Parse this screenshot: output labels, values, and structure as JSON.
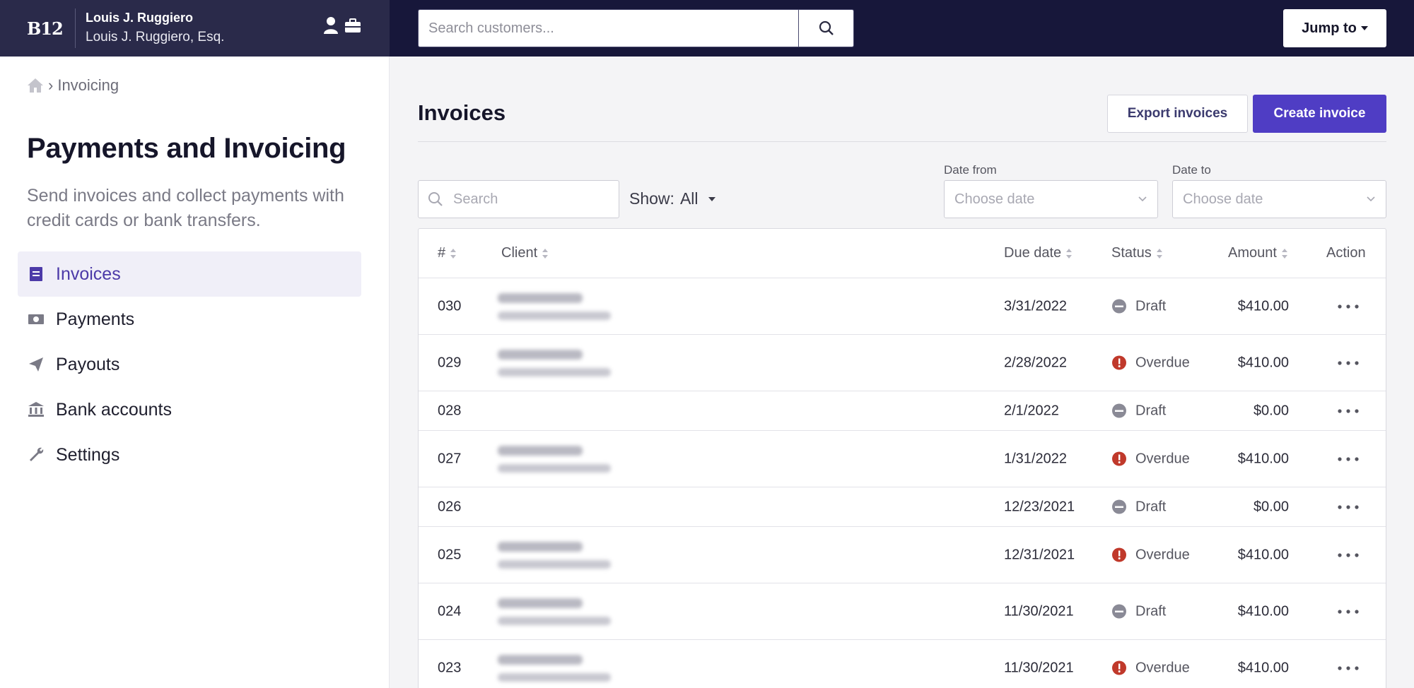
{
  "colors": {
    "accent": "#4f3dc4",
    "topbar": "#17173a",
    "sidebar_header": "#2a2a4a",
    "draft": "#8a8a96",
    "overdue": "#c0392b",
    "active_nav_bg": "#f0eff8"
  },
  "sidebar": {
    "logo": "B12",
    "user_name": "Louis J. Ruggiero",
    "user_org": "Louis J. Ruggiero, Esq.",
    "breadcrumb": {
      "sep": "›",
      "current": "Invoicing"
    },
    "title": "Payments and Invoicing",
    "description": "Send invoices and collect payments with credit cards or bank transfers.",
    "items": [
      {
        "label": "Invoices",
        "icon": "invoice-icon",
        "active": true
      },
      {
        "label": "Payments",
        "icon": "cash-icon",
        "active": false
      },
      {
        "label": "Payouts",
        "icon": "paper-plane-icon",
        "active": false
      },
      {
        "label": "Bank accounts",
        "icon": "bank-icon",
        "active": false
      },
      {
        "label": "Settings",
        "icon": "wrench-icon",
        "active": false
      }
    ]
  },
  "header": {
    "search_placeholder": "Search customers...",
    "jump_label": "Jump to"
  },
  "main": {
    "title": "Invoices",
    "export_label": "Export invoices",
    "create_label": "Create invoice",
    "filter_search_placeholder": "Search",
    "show_label": "Show:",
    "show_value": "All",
    "date_from_label": "Date from",
    "date_to_label": "Date to",
    "date_placeholder": "Choose date"
  },
  "table": {
    "columns": [
      "#",
      "Client",
      "Due date",
      "Status",
      "Amount",
      "Action"
    ],
    "rows": [
      {
        "num": "030",
        "client_blurred": true,
        "due": "3/31/2022",
        "status": "Draft",
        "amount": "$410.00"
      },
      {
        "num": "029",
        "client_blurred": true,
        "due": "2/28/2022",
        "status": "Overdue",
        "amount": "$410.00"
      },
      {
        "num": "028",
        "client_blurred": false,
        "due": "2/1/2022",
        "status": "Draft",
        "amount": "$0.00"
      },
      {
        "num": "027",
        "client_blurred": true,
        "due": "1/31/2022",
        "status": "Overdue",
        "amount": "$410.00"
      },
      {
        "num": "026",
        "client_blurred": false,
        "due": "12/23/2021",
        "status": "Draft",
        "amount": "$0.00"
      },
      {
        "num": "025",
        "client_blurred": true,
        "due": "12/31/2021",
        "status": "Overdue",
        "amount": "$410.00"
      },
      {
        "num": "024",
        "client_blurred": true,
        "due": "11/30/2021",
        "status": "Draft",
        "amount": "$410.00"
      },
      {
        "num": "023",
        "client_blurred": true,
        "due": "11/30/2021",
        "status": "Overdue",
        "amount": "$410.00"
      }
    ]
  }
}
